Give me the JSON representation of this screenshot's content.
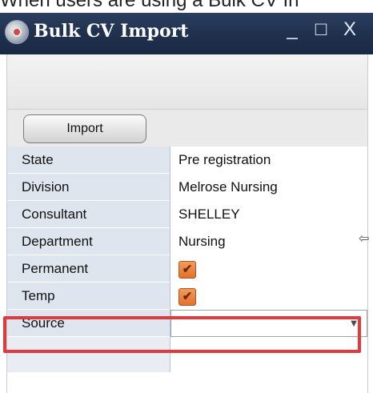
{
  "caption": "When users are using a Bulk CV In",
  "window": {
    "title": "Bulk CV Import",
    "controls": [
      "_",
      "□",
      "X"
    ]
  },
  "toolbar": {
    "import_label": "Import"
  },
  "form": {
    "rows": [
      {
        "label": "State",
        "value": "Pre registration"
      },
      {
        "label": "Division",
        "value": "Melrose Nursing"
      },
      {
        "label": "Consultant",
        "value": "SHELLEY"
      },
      {
        "label": "Department",
        "value": "Nursing"
      },
      {
        "label": "Permanent",
        "checked": true
      },
      {
        "label": "Temp",
        "checked": true
      }
    ],
    "source": {
      "label": "Source",
      "value": ""
    }
  },
  "colors": {
    "titlebar": "#20314f",
    "checkbox": "#e2702c",
    "highlight": "#e03a3f"
  }
}
